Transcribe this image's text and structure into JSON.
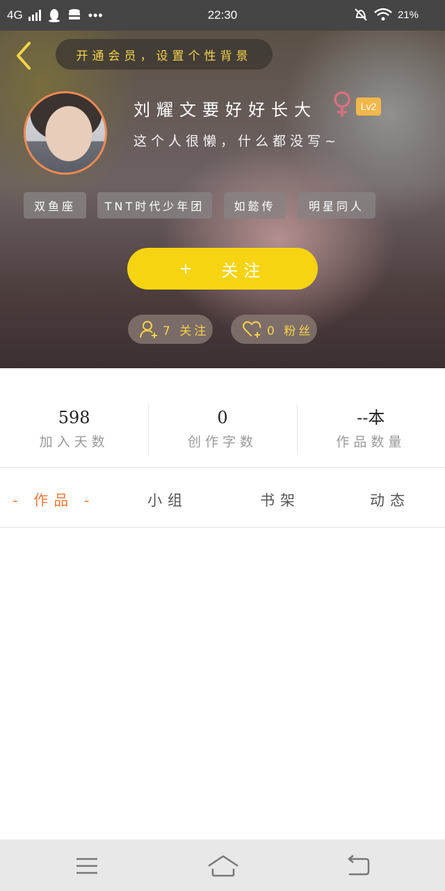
{
  "status_bar": {
    "network": "4G",
    "time": "22:30",
    "battery": "21%",
    "icons": [
      "signal-icon",
      "qq-icon",
      "storage-icon",
      "more-dots-icon",
      "mute-icon",
      "wifi-icon",
      "battery-icon"
    ]
  },
  "header": {
    "banner_text": "开通会员，设置个性背景"
  },
  "profile": {
    "name": "刘耀文要好好长大",
    "level": "Lv2",
    "bio": "这个人很懒，什么都没写~",
    "tags": [
      "双鱼座",
      "TNT时代少年团",
      "如懿传",
      "明星同人"
    ],
    "follow_label": "关注",
    "follow_plus": "+",
    "following_label": "7 关注",
    "fans_label": "0 粉丝"
  },
  "stats": [
    {
      "value": "598",
      "label": "加入天数"
    },
    {
      "value": "0",
      "label": "创作字数"
    },
    {
      "value": "--本",
      "label": "作品数量"
    }
  ],
  "tabs": {
    "active_label": "- 作品 -",
    "items": [
      "作品",
      "小组",
      "书架",
      "动态"
    ]
  },
  "colors": {
    "accent_yellow": "#f7d411",
    "banner_text": "#f5d34a",
    "active_tab": "#f07a3c",
    "level_badge": "#f1b84a",
    "avatar_border": "#ef8a54",
    "gender_icon": "#d8707f"
  }
}
